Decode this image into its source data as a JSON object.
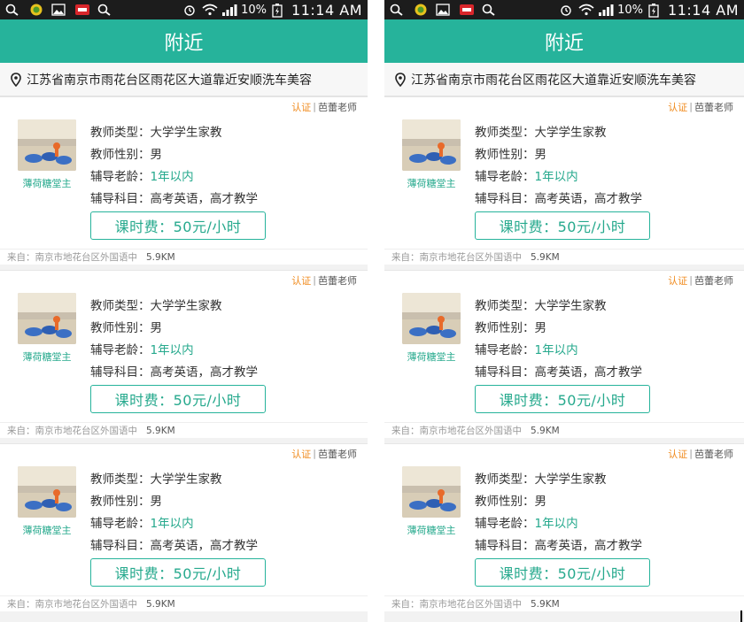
{
  "status": {
    "battery_pct": "10%",
    "time": "11:14 AM"
  },
  "header": {
    "title": "附近"
  },
  "location": {
    "text": "江苏省南京市雨花台区雨花区大道靠近安顺洗车美容"
  },
  "colors": {
    "accent": "#26b39b",
    "cert": "#f08a1c"
  },
  "cards": [
    {
      "cert": "认证",
      "teacher": "芭蕾老师",
      "avatar_name": "薄荷糖堂主",
      "type_label": "教师类型：",
      "type": "大学学生家教",
      "gender_label": "教师性别：",
      "gender": "男",
      "exp_label": "辅导老龄：",
      "exp": "1年以内",
      "subject_label": "辅导科目：",
      "subject": "高考英语，高才教学",
      "fee": "课时费：50元/小时",
      "from": "来自：南京市地花台区外国语中",
      "distance": "5.9KM"
    },
    {
      "cert": "认证",
      "teacher": "芭蕾老师",
      "avatar_name": "薄荷糖堂主",
      "type_label": "教师类型：",
      "type": "大学学生家教",
      "gender_label": "教师性别：",
      "gender": "男",
      "exp_label": "辅导老龄：",
      "exp": "1年以内",
      "subject_label": "辅导科目：",
      "subject": "高考英语，高才教学",
      "fee": "课时费：50元/小时",
      "from": "来自：南京市地花台区外国语中",
      "distance": "5.9KM"
    },
    {
      "cert": "认证",
      "teacher": "芭蕾老师",
      "avatar_name": "薄荷糖堂主",
      "type_label": "教师类型：",
      "type": "大学学生家教",
      "gender_label": "教师性别：",
      "gender": "男",
      "exp_label": "辅导老龄：",
      "exp": "1年以内",
      "subject_label": "辅导科目：",
      "subject": "高考英语，高才教学",
      "fee": "课时费：50元/小时",
      "from": "来自：南京市地花台区外国语中",
      "distance": "5.9KM"
    }
  ]
}
